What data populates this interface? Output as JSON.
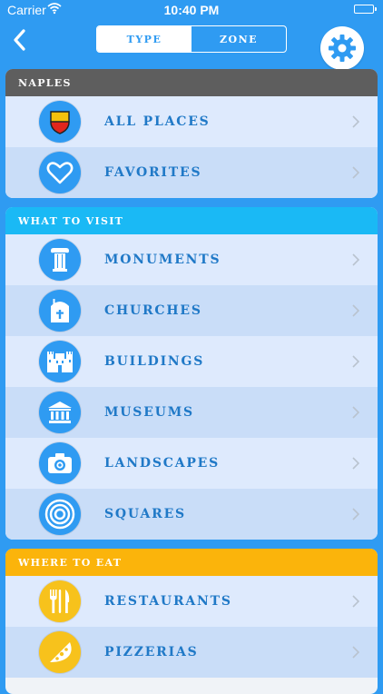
{
  "status_bar": {
    "carrier": "Carrier",
    "time": "10:40 PM"
  },
  "nav": {
    "tabs": [
      {
        "label": "Type",
        "active": true
      },
      {
        "label": "Zone",
        "active": false
      }
    ]
  },
  "colors": {
    "background": "#2f9bf2",
    "header_naples": "#5e5e5e",
    "header_visit": "#1ab9f5",
    "header_eat": "#fbb40b",
    "icon_blue": "#2f9bf2",
    "icon_yellow": "#f7c21c",
    "label": "#2079c7"
  },
  "sections": [
    {
      "header": "Naples",
      "items": [
        {
          "label": "All Places",
          "icon": "naples-crest-icon"
        },
        {
          "label": "Favorites",
          "icon": "heart-icon"
        }
      ]
    },
    {
      "header": "What to Visit",
      "items": [
        {
          "label": "Monuments",
          "icon": "column-icon"
        },
        {
          "label": "Churches",
          "icon": "church-icon"
        },
        {
          "label": "Buildings",
          "icon": "castle-icon"
        },
        {
          "label": "Museums",
          "icon": "museum-icon"
        },
        {
          "label": "Landscapes",
          "icon": "camera-icon"
        },
        {
          "label": "Squares",
          "icon": "target-icon"
        }
      ]
    },
    {
      "header": "Where to Eat",
      "items": [
        {
          "label": "Restaurants",
          "icon": "cutlery-icon"
        },
        {
          "label": "Pizzerias",
          "icon": "pizza-slice-icon"
        }
      ]
    }
  ]
}
